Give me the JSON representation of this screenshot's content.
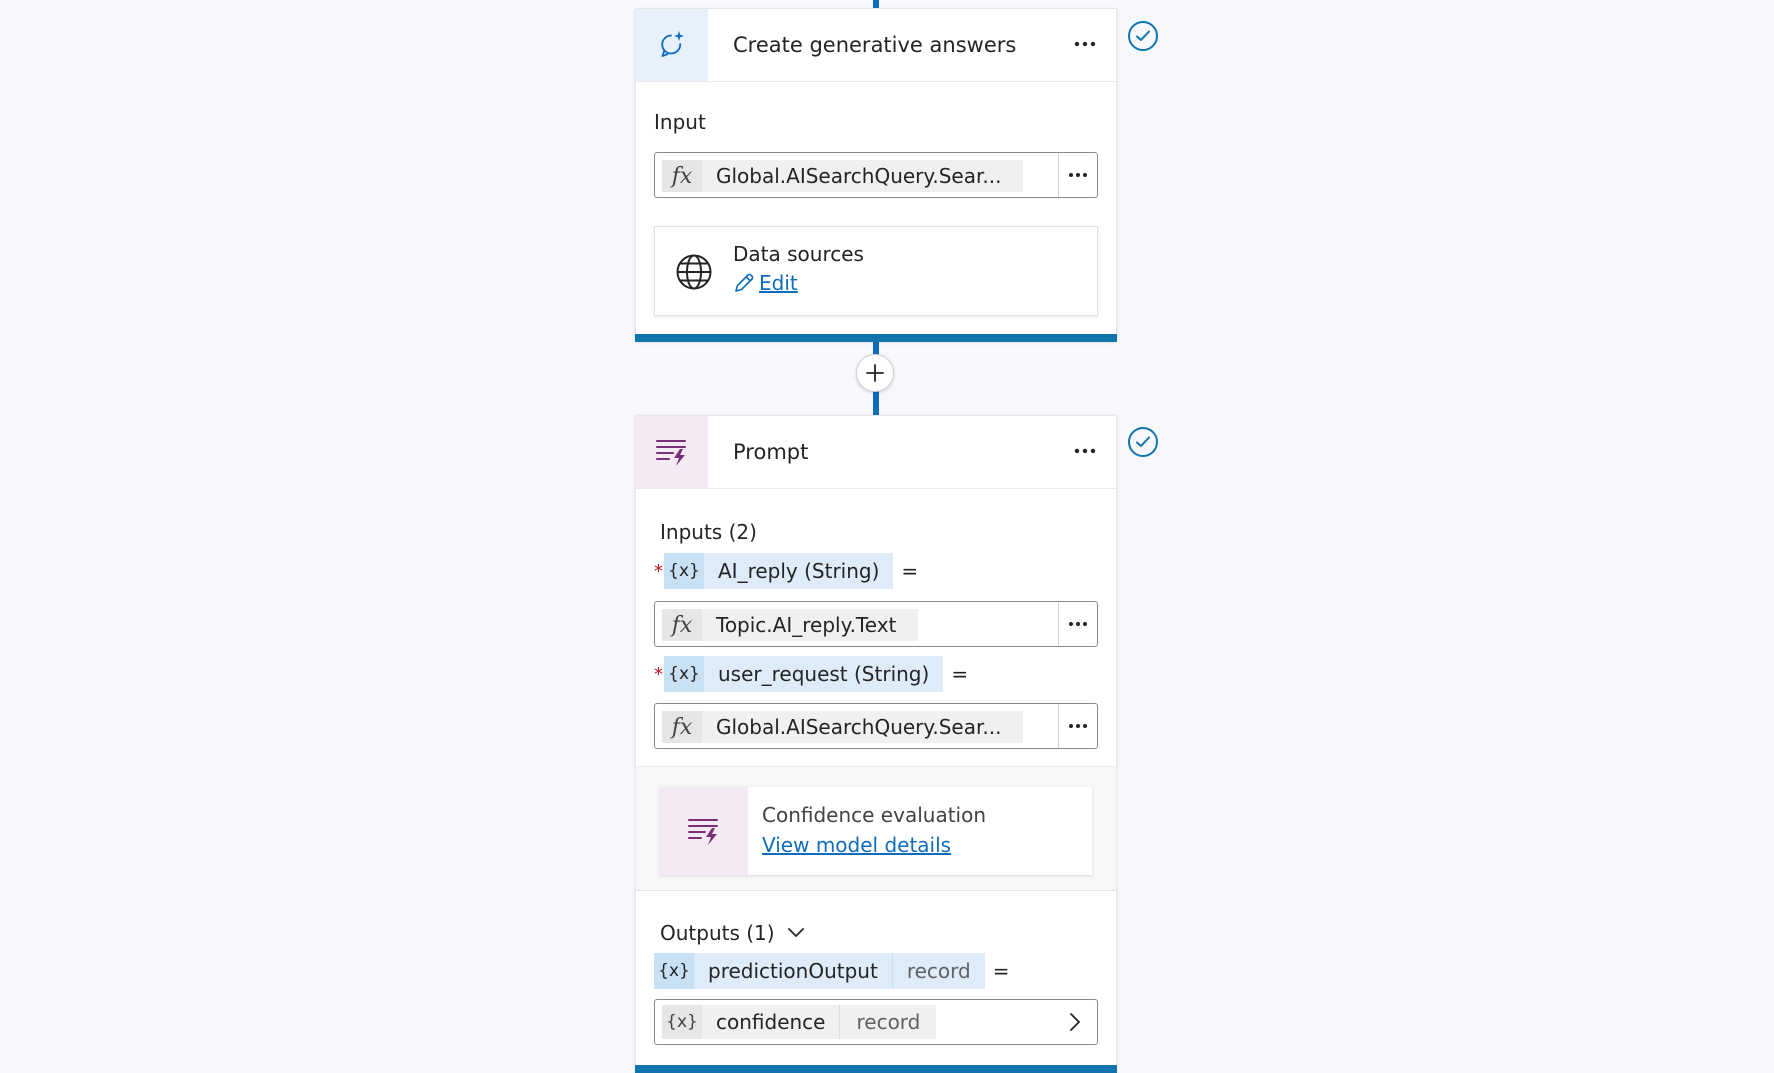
{
  "colors": {
    "accent": "#0f6cbd",
    "bottom_bar": "#1274ac",
    "required": "#c50f1f"
  },
  "card1": {
    "title": "Create generative answers",
    "icon": "sparkle-chat-icon",
    "input_label": "Input",
    "input_value": "Global.AISearchQuery.Sear...",
    "data_sources_label": "Data sources",
    "data_sources_icon": "globe-icon",
    "edit_label": "Edit"
  },
  "card2": {
    "title": "Prompt",
    "icon": "prompt-icon",
    "inputs_label": "Inputs (2)",
    "inputs": [
      {
        "name": "AI_reply (String)",
        "value": "Topic.AI_reply.Text"
      },
      {
        "name": "user_request (String)",
        "value": "Global.AISearchQuery.Sear..."
      }
    ],
    "confidence_title": "Confidence evaluation",
    "confidence_link": "View model details",
    "outputs_label": "Outputs (1)",
    "output": {
      "name": "predictionOutput",
      "type": "record"
    },
    "output_field": {
      "name": "confidence",
      "type": "record"
    }
  },
  "symbols": {
    "fx": "fx",
    "var": "{x}",
    "equals": "=",
    "required": "*"
  }
}
